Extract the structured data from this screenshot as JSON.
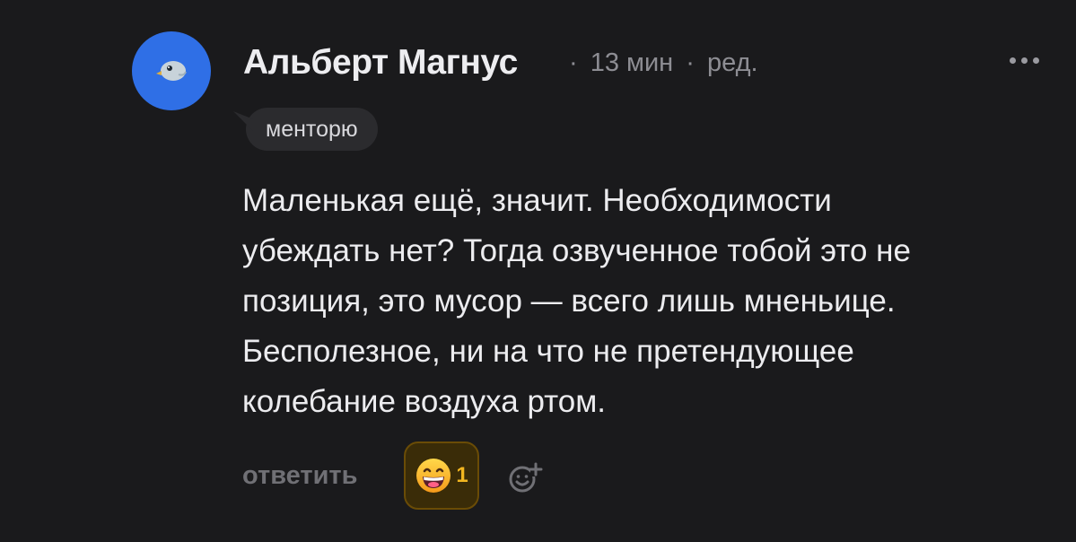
{
  "comment": {
    "author": "Альберт Магнус",
    "time": "13 мин",
    "edited": "ред.",
    "separator": "·",
    "reply_to": "менторю",
    "text_lines": [
      "Маленькая ещё, значит. Необходимости",
      "убеждать нет? Тогда озвученное тобой это не",
      "позиция, это мусор — всего лишь мненьице.",
      "Бесполезное, ни на что не претендующее",
      "колебание воздуха ртом."
    ]
  },
  "actions": {
    "reply_label": "ответить",
    "reactions": [
      {
        "icon": "grinning-face-emoji",
        "count": "1"
      }
    ],
    "add_reaction_icon": "add-reaction-icon",
    "more_icon": "more-dots-icon"
  },
  "colors": {
    "background": "#1a1a1c",
    "avatar_bg": "#2f6fe6",
    "reaction_bg": "#3a2c08",
    "reaction_border": "#6a4c06",
    "reaction_count": "#f2b620",
    "muted_text": "#8d8d93"
  }
}
